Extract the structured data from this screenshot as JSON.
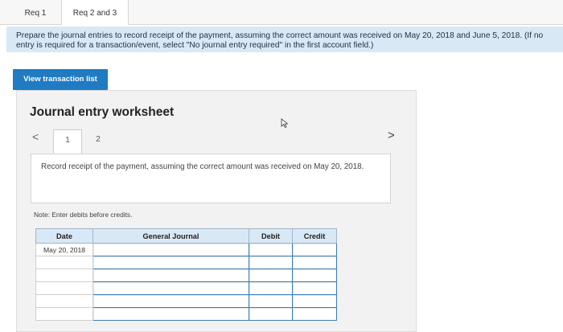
{
  "tabs": [
    {
      "label": "Req 1"
    },
    {
      "label": "Req 2 and 3"
    }
  ],
  "instruction": "Prepare the journal entries to record receipt of the payment, assuming the correct amount was received on May 20, 2018 and June 5, 2018. (If no entry is required for a transaction/event, select \"No journal entry required\" in the first account field.)",
  "view_button_label": "View transaction list",
  "worksheet": {
    "title": "Journal entry worksheet",
    "steps": [
      "1",
      "2"
    ],
    "prev_arrow": "<",
    "next_arrow": ">",
    "description": "Record receipt of the payment, assuming the correct amount was received on May 20, 2018.",
    "note": "Note: Enter debits before credits.",
    "columns": {
      "date": "Date",
      "account": "General Journal",
      "debit": "Debit",
      "credit": "Credit"
    },
    "rows": [
      {
        "date": "May 20, 2018"
      },
      {
        "date": ""
      },
      {
        "date": ""
      },
      {
        "date": ""
      },
      {
        "date": ""
      },
      {
        "date": ""
      }
    ]
  }
}
